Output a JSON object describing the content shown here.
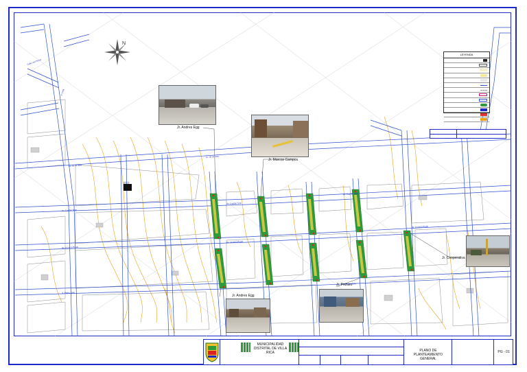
{
  "labels": {
    "jr_andres_egg_top": "Jr. Andres Egg",
    "jr_marcos_campos": "Jr. Marcos Campos",
    "jr_cooperativa": "Jr. Cooperativa",
    "jr_andres_egg_bottom": "Jr. Andres Egg",
    "jr_pozuzo": "Jr. Pozuzo"
  },
  "legend": {
    "title": "LEYENDA"
  },
  "title_block": {
    "municipality": "MUNICIPALIDAD DISTRITAL DE VILLA RICA",
    "sheet_title": "PLANO DE PLANTEAMIENTO GENERAL",
    "sheet_code": "PG - 01"
  },
  "colors": {
    "frame": "#1d28c9",
    "contour": "#e8a21c",
    "road": "#2d4fd1",
    "green_strip": "#2f9a3a",
    "lot": "#777777"
  }
}
